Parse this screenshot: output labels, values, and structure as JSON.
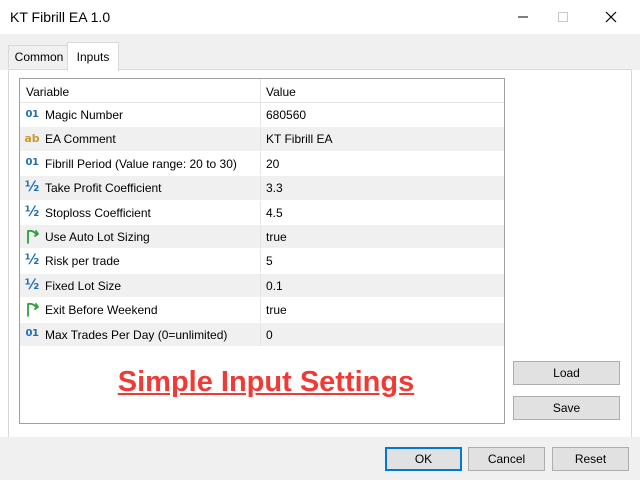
{
  "window": {
    "title": "KT Fibrill EA 1.0"
  },
  "tabs": [
    {
      "label": "Common"
    },
    {
      "label": "Inputs"
    }
  ],
  "grid": {
    "columns": [
      "Variable",
      "Value"
    ],
    "rows": [
      {
        "icon": "integer-icon",
        "icon_text": "01",
        "variable": "Magic Number",
        "value": "680560"
      },
      {
        "icon": "string-icon",
        "icon_text": "ab",
        "variable": "EA Comment",
        "value": "KT Fibrill EA"
      },
      {
        "icon": "integer-icon",
        "icon_text": "01",
        "variable": "Fibrill Period (Value range: 20 to 30)",
        "value": "20"
      },
      {
        "icon": "double-icon",
        "icon_text": "½",
        "variable": "Take Profit Coefficient",
        "value": "3.3"
      },
      {
        "icon": "double-icon",
        "icon_text": "½",
        "variable": "Stoploss Coefficient",
        "value": "4.5"
      },
      {
        "icon": "bool-icon",
        "icon_text": "",
        "variable": "Use Auto Lot Sizing",
        "value": "true"
      },
      {
        "icon": "double-icon",
        "icon_text": "½",
        "variable": "Risk per trade",
        "value": "5"
      },
      {
        "icon": "double-icon",
        "icon_text": "½",
        "variable": "Fixed Lot Size",
        "value": "0.1"
      },
      {
        "icon": "bool-icon",
        "icon_text": "",
        "variable": "Exit Before Weekend",
        "value": "true"
      },
      {
        "icon": "integer-icon",
        "icon_text": "01",
        "variable": "Max Trades Per Day (0=unlimited)",
        "value": "0"
      }
    ]
  },
  "overlay_text": "Simple Input Settings",
  "side_buttons": {
    "load": "Load",
    "save": "Save"
  },
  "footer_buttons": {
    "ok": "OK",
    "cancel": "Cancel",
    "reset": "Reset"
  },
  "colors": {
    "accent": "#0078d7",
    "overlay": "#ef3b36",
    "icon_blue": "#1e6fb5",
    "icon_gold": "#c99a2e",
    "icon_green": "#2e9e3e"
  }
}
